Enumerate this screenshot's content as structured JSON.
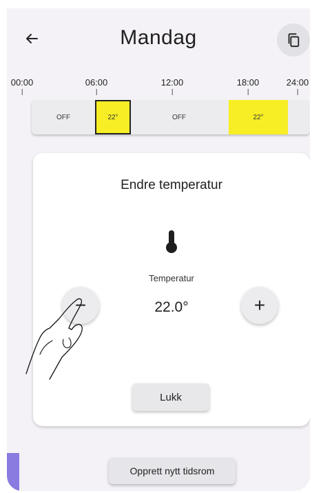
{
  "header": {
    "title": "Mandag",
    "back_icon": "arrow-left-icon",
    "copy_icon": "copy-icon"
  },
  "timeline": {
    "ticks": [
      "00:00",
      "06:00",
      "12:00",
      "18:00",
      "24:00"
    ],
    "segments": [
      {
        "label": "OFF",
        "selected": false,
        "color": "#ececef"
      },
      {
        "label": "22°",
        "selected": true,
        "color": "#f7ee26"
      },
      {
        "label": "OFF",
        "selected": false,
        "color": "#ececef"
      },
      {
        "label": "22°",
        "selected": false,
        "color": "#f7ee26"
      }
    ]
  },
  "dialog": {
    "title": "Endre temperatur",
    "icon": "thermometer-icon",
    "temperature_label": "Temperatur",
    "temperature_value": "22.0°",
    "decrease_label": "−",
    "increase_label": "+",
    "close_label": "Lukk"
  },
  "actions": {
    "new_timespan_label": "Opprett nytt tidsrom"
  },
  "colors": {
    "accent_yellow": "#f7ee26",
    "background": "#f4f2f7",
    "corner_accent": "#8a7be0"
  }
}
